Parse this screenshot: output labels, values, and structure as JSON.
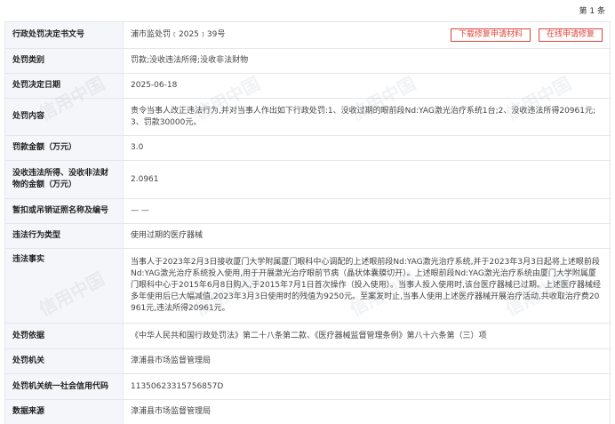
{
  "page": {
    "label": "第 1 条"
  },
  "buttons": {
    "download": "下载修复申请材料",
    "apply": "在线申请修复"
  },
  "watermark": {
    "text": "信用中国"
  },
  "rows": [
    {
      "label": "行政处罚决定书文号",
      "value": "浦市监处罚﹝2025﹞39号"
    },
    {
      "label": "处罚类别",
      "value": "罚款;没收违法所得;没收非法财物"
    },
    {
      "label": "处罚决定日期",
      "value": "2025-06-18"
    },
    {
      "label": "处罚内容",
      "value": "责令当事人改正违法行为,并对当事人作出如下行政处罚:1、没收过期的眼前段Nd:YAG激光治疗系统1台;2、没收违法所得20961元;3、罚款30000元。"
    },
    {
      "label": "罚款金额（万元）",
      "value": "3.0"
    },
    {
      "label": "没收违法所得、没收非法财物的金额（万元）",
      "value": "2.0961"
    },
    {
      "label": "暂扣或吊销证照名称及编号",
      "value": "— —"
    },
    {
      "label": "违法行为类型",
      "value": "使用过期的医疗器械"
    },
    {
      "label": "违法事实",
      "value": "当事人于2023年2月3日接收厦门大学附属厦门眼科中心调配的上述眼前段Nd:YAG激光治疗系统,并于2023年3月3日起将上述眼前段Nd:YAG激光治疗系统投入使用,用于开展激光治疗眼前节病（晶状体囊膜切开）。上述眼前段Nd:YAG激光治疗系统由厦门大学附属厦门眼科中心于2015年6月8日购入,于2015年7月1日首次操作（投入使用）。当事人投入使用时,该台医疗器械已过期。上述医疗器械经多年使用后已大幅减值,2023年3月3日使用时的残值为9250元。至案发时止,当事人使用上述医疗器械开展治疗活动,共收取治疗费20961元,违法所得20961元。"
    },
    {
      "label": "处罚依据",
      "value": "《中华人民共和国行政处罚法》第二十八条第二款、《医疗器械监督管理条例》第八十六条第（三）项"
    },
    {
      "label": "处罚机关",
      "value": "漳浦县市场监督管理局"
    },
    {
      "label": "处罚机关统一社会信用代码",
      "value": "11350623315756857D"
    },
    {
      "label": "数据来源",
      "value": "漳浦县市场监督管理局"
    }
  ]
}
